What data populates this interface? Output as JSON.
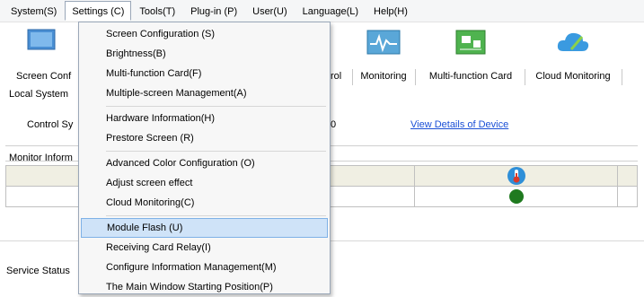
{
  "menubar": {
    "items": [
      {
        "label": "System(S)"
      },
      {
        "label": "Settings (C)"
      },
      {
        "label": "Tools(T)"
      },
      {
        "label": "Plug-in (P)"
      },
      {
        "label": "User(U)"
      },
      {
        "label": "Language(L)"
      },
      {
        "label": "Help(H)"
      }
    ],
    "active_index": 1
  },
  "toolbar": {
    "screen_config_label": "Screen Conf",
    "control_label": "rol",
    "monitoring_label": "Monitoring",
    "multifunction_label": "Multi-function Card",
    "cloud_label": "Cloud Monitoring"
  },
  "local_system": {
    "title": "Local System",
    "control_label": "Control Sy",
    "count_fragment": "0",
    "details_link": "View Details of Device"
  },
  "monitor": {
    "title": "Monitor Inform",
    "status_color": "#1f7a1f"
  },
  "status": {
    "label": "Service Status"
  },
  "settings_menu": {
    "items": [
      "Screen Configuration (S)",
      "Brightness(B)",
      "Multi-function Card(F)",
      "Multiple-screen Management(A)",
      "Hardware Information(H)",
      "Prestore Screen (R)",
      "Advanced Color Configuration (O)",
      "Adjust screen effect",
      "Cloud Monitoring(C)",
      "Module Flash (U)",
      "Receiving Card Relay(I)",
      "Configure Information Management(M)",
      "The Main Window Starting Position(P)"
    ],
    "highlighted": "Module Flash (U)"
  }
}
